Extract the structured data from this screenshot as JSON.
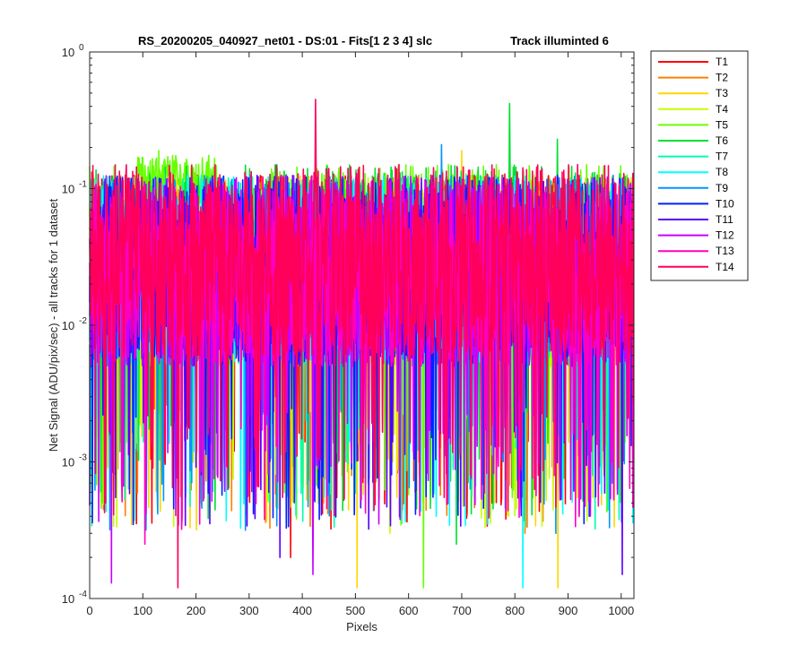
{
  "chart_data": {
    "type": "line",
    "title": "RS_20200205_040927_net01 - DS:01 - Fits[1  2  3  4]   slc",
    "subtitle": "Track illuminted 6",
    "xlabel": "Pixels",
    "ylabel": "Net Signal (ADU/pix/sec) - all tracks for 1 dataset",
    "xlim": [
      0,
      1024
    ],
    "ylim": [
      0.0001,
      1
    ],
    "yscale": "log",
    "grid": false,
    "legend_position": "outside-top-right",
    "x_ticks": [
      "0",
      "100",
      "200",
      "300",
      "400",
      "500",
      "600",
      "700",
      "800",
      "900",
      "1000"
    ],
    "y_ticks": [
      "10",
      "10",
      "10",
      "10",
      "10"
    ],
    "y_tick_exponents": [
      "-4",
      "-3",
      "-2",
      "-1",
      "0"
    ],
    "x_range_points": [
      0,
      1023
    ],
    "series": [
      {
        "name": "T1",
        "color": "#ff0000",
        "typical_level": 0.025,
        "min_dips": [
          0.0002,
          0.0005
        ]
      },
      {
        "name": "T2",
        "color": "#ff7f00",
        "typical_level": 0.025,
        "min_dips": [
          0.0005,
          0.0003
        ]
      },
      {
        "name": "T3",
        "color": "#ffd700",
        "typical_level": 0.025,
        "peaks": [
          {
            "x": 700,
            "y": 0.19
          }
        ],
        "min_dips": [
          0.00012,
          0.00012
        ]
      },
      {
        "name": "T4",
        "color": "#c4ff00",
        "typical_level": 0.025,
        "min_dips": [
          0.0003
        ]
      },
      {
        "name": "T5",
        "color": "#66ff00",
        "typical_level": 0.03,
        "peaks": [
          {
            "x": 130,
            "y": 0.19
          },
          {
            "x": 200,
            "y": 0.15
          }
        ],
        "min_dips": [
          0.00012
        ]
      },
      {
        "name": "T6",
        "color": "#00e030",
        "typical_level": 0.03,
        "peaks": [
          {
            "x": 790,
            "y": 0.42
          },
          {
            "x": 880,
            "y": 0.23
          }
        ],
        "min_dips": [
          0.00025
        ]
      },
      {
        "name": "T7",
        "color": "#00ffb0",
        "typical_level": 0.025,
        "min_dips": [
          0.0004
        ]
      },
      {
        "name": "T8",
        "color": "#00ffff",
        "typical_level": 0.025,
        "min_dips": [
          0.00012
        ]
      },
      {
        "name": "T9",
        "color": "#0095ff",
        "typical_level": 0.025,
        "peaks": [
          {
            "x": 662,
            "y": 0.21
          }
        ],
        "min_dips": [
          0.0003
        ]
      },
      {
        "name": "T10",
        "color": "#0020ff",
        "typical_level": 0.025,
        "min_dips": [
          0.0004
        ]
      },
      {
        "name": "T11",
        "color": "#5a00ff",
        "typical_level": 0.025,
        "min_dips": [
          0.00015,
          0.0002
        ]
      },
      {
        "name": "T12",
        "color": "#c800ff",
        "typical_level": 0.025,
        "min_dips": [
          0.00013,
          0.00015
        ]
      },
      {
        "name": "T13",
        "color": "#ff00c0",
        "typical_level": 0.025,
        "min_dips": [
          0.00025
        ]
      },
      {
        "name": "T14",
        "color": "#ff005a",
        "typical_level": 0.03,
        "peaks": [
          {
            "x": 425,
            "y": 0.45
          }
        ],
        "min_dips": [
          0.00012
        ]
      }
    ]
  }
}
